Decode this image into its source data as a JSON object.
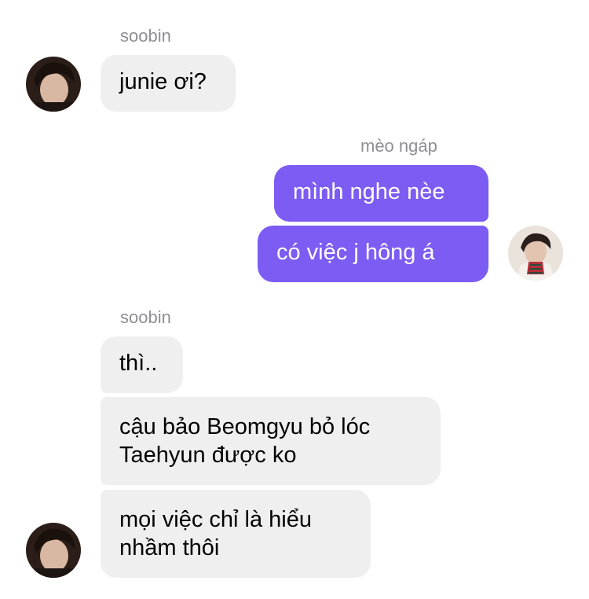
{
  "chat": {
    "group1": {
      "sender": "soobin",
      "messages": [
        "junie ơi?"
      ]
    },
    "group2": {
      "sender": "mèo ngáp",
      "messages": [
        "mình nghe nèe",
        "có việc j hông á"
      ]
    },
    "group3": {
      "sender": "soobin",
      "messages": [
        [
          "thì.."
        ],
        [
          "cậu bảo Beomgyu bỏ lóc",
          "Taehyun được ko"
        ],
        [
          "mọi việc chỉ là hiểu",
          "nhầm thôi"
        ]
      ]
    }
  },
  "colors": {
    "incoming_bubble": "#efefef",
    "outgoing_bubble": "#7c5cf2",
    "sender_name": "#8e8e93"
  },
  "icons": {
    "soobin_avatar": "avatar-photo-dark",
    "meo_ngap_avatar": "avatar-photo-light"
  }
}
